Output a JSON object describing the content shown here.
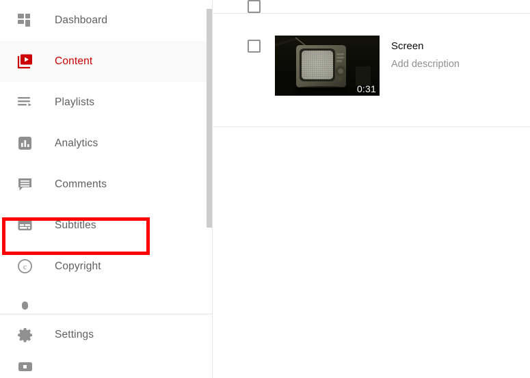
{
  "sidebar": {
    "items": [
      {
        "label": "Dashboard",
        "icon": "dashboard-grid-icon",
        "active": false
      },
      {
        "label": "Content",
        "icon": "content-video-icon",
        "active": true
      },
      {
        "label": "Playlists",
        "icon": "playlists-icon",
        "active": false
      },
      {
        "label": "Analytics",
        "icon": "analytics-bar-icon",
        "active": false
      },
      {
        "label": "Comments",
        "icon": "comments-bubble-icon",
        "active": false
      },
      {
        "label": "Subtitles",
        "icon": "subtitles-icon",
        "active": false
      },
      {
        "label": "Copyright",
        "icon": "copyright-icon",
        "active": false
      }
    ],
    "bottom_items": [
      {
        "label": "Settings",
        "icon": "gear-icon"
      }
    ],
    "active_color": "#cc0000",
    "label_color": "#606060",
    "active_row_background": "#f9f9f9",
    "scrollbar_thumb_color": "#cdcdcd"
  },
  "content": {
    "videos": [
      {
        "title": "Screen",
        "description_placeholder": "Add description",
        "duration": "0:31",
        "checkbox_checked": false,
        "thumbnail_alt": "retro-crt-television-with-static-in-dark-room"
      }
    ]
  },
  "annotation": {
    "target": "Subtitles",
    "color": "#ff0000",
    "shape": "rectangle-outline"
  }
}
